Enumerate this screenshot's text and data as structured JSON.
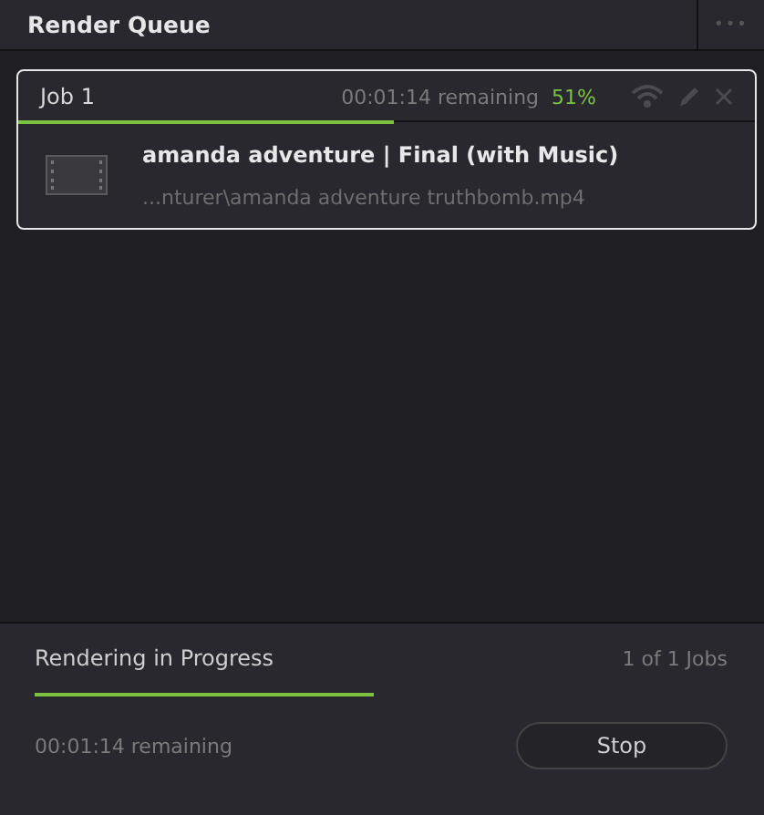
{
  "panel": {
    "title": "Render Queue",
    "menu": "•••"
  },
  "jobs": [
    {
      "name": "Job 1",
      "remaining": "00:01:14 remaining",
      "percent": "51%",
      "level": 0.51,
      "selected": true,
      "title": "amanda adventure | Final (with Music)",
      "path": "...nturer\\amanda adventure truthbomb.mp4"
    }
  ],
  "footer": {
    "status": "Rendering in Progress",
    "count": "1 of 1 Jobs",
    "remaining": "00:01:14 remaining",
    "button": "Stop"
  }
}
